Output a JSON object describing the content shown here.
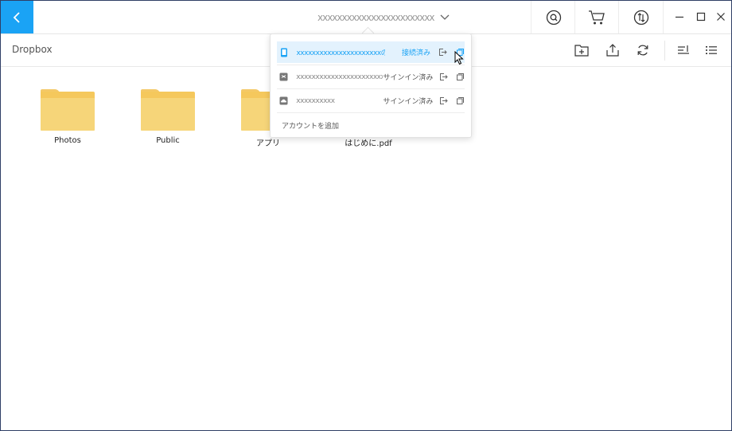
{
  "header": {
    "device_title": "xxxxxxxxxxxxxxxxxxxxxxxx",
    "icons": [
      "back-arrow-icon",
      "search-icon",
      "cart-icon",
      "transfer-icon",
      "minimize-icon",
      "maximize-icon",
      "close-icon"
    ]
  },
  "toolbar": {
    "breadcrumb": "Dropbox",
    "icons": [
      "new-folder-icon",
      "upload-icon",
      "refresh-icon",
      "sort-icon",
      "list-view-icon"
    ]
  },
  "files": [
    {
      "name": "Photos",
      "type": "folder"
    },
    {
      "name": "Public",
      "type": "folder"
    },
    {
      "name": "アプリ",
      "type": "folder"
    },
    {
      "name": "はじめに.pdf",
      "type": "pdf"
    }
  ],
  "account_menu": {
    "accounts": [
      {
        "name": "xxxxxxxxxxxxxxxxxxxxxxのiP...",
        "status": "接続済み",
        "service": "iphone",
        "active": true
      },
      {
        "name": "xxxxxxxxxxxxxxxxxxxxxxxxxx",
        "status": "サインイン済み",
        "service": "dropbox",
        "active": false
      },
      {
        "name": "xxxxxxxxxx",
        "status": "サインイン済み",
        "service": "cloud",
        "active": false
      }
    ],
    "add_account_label": "アカウントを追加"
  },
  "colors": {
    "accent": "#1aa3f5",
    "folder": "#f6d579",
    "active_row": "#e3f2fd",
    "window_border": "#2f3f66"
  }
}
